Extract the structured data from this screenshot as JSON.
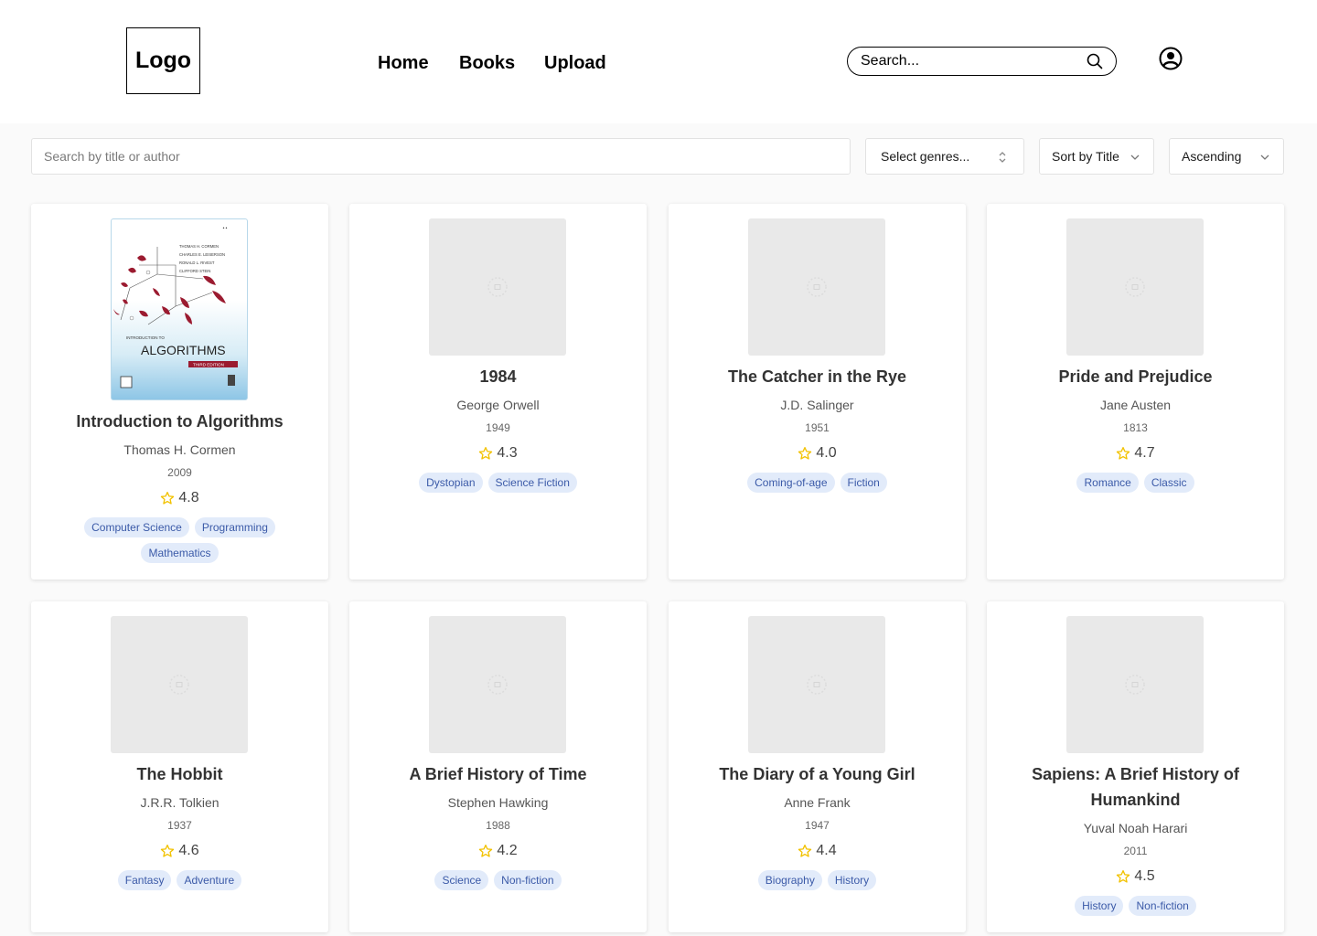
{
  "header": {
    "logo": "Logo",
    "nav": [
      "Home",
      "Books",
      "Upload"
    ],
    "search_placeholder": "Search..."
  },
  "filters": {
    "search_placeholder": "Search by title or author",
    "genres_label": "Select genres...",
    "sort_label": "Sort by Title",
    "order_label": "Ascending"
  },
  "books": [
    {
      "title": "Introduction to Algorithms",
      "author": "Thomas H. Cormen",
      "year": "2009",
      "rating": "4.8",
      "tags": [
        "Computer Science",
        "Programming",
        "Mathematics"
      ],
      "cover": {
        "authors": [
          "THOMAS H. CORMEN",
          "CHARLES E. LEISERSON",
          "RONALD L. RIVEST",
          "CLIFFORD STEIN"
        ],
        "pre": "INTRODUCTION TO",
        "name": "ALGORITHMS",
        "edition": "THIRD EDITION"
      }
    },
    {
      "title": "1984",
      "author": "George Orwell",
      "year": "1949",
      "rating": "4.3",
      "tags": [
        "Dystopian",
        "Science Fiction"
      ]
    },
    {
      "title": "The Catcher in the Rye",
      "author": "J.D. Salinger",
      "year": "1951",
      "rating": "4.0",
      "tags": [
        "Coming-of-age",
        "Fiction"
      ]
    },
    {
      "title": "Pride and Prejudice",
      "author": "Jane Austen",
      "year": "1813",
      "rating": "4.7",
      "tags": [
        "Romance",
        "Classic"
      ]
    },
    {
      "title": "The Hobbit",
      "author": "J.R.R. Tolkien",
      "year": "1937",
      "rating": "4.6",
      "tags": [
        "Fantasy",
        "Adventure"
      ]
    },
    {
      "title": "A Brief History of Time",
      "author": "Stephen Hawking",
      "year": "1988",
      "rating": "4.2",
      "tags": [
        "Science",
        "Non-fiction"
      ]
    },
    {
      "title": "The Diary of a Young Girl",
      "author": "Anne Frank",
      "year": "1947",
      "rating": "4.4",
      "tags": [
        "Biography",
        "History"
      ]
    },
    {
      "title": "Sapiens: A Brief History of Humankind",
      "author": "Yuval Noah Harari",
      "year": "2011",
      "rating": "4.5",
      "tags": [
        "History",
        "Non-fiction"
      ]
    }
  ],
  "colors": {
    "star": "#f2c200",
    "tag_bg": "#e2ebfa",
    "tag_text": "#3b5aa8",
    "placeholder": "#e9e9e9"
  }
}
